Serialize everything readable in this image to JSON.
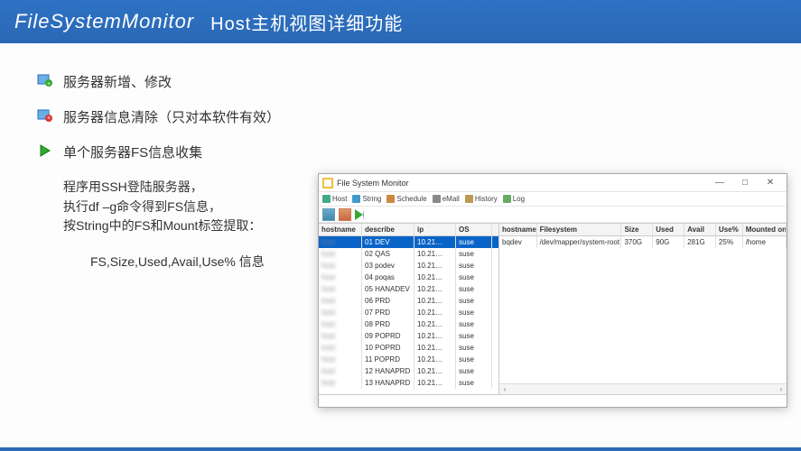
{
  "header": {
    "title": "FileSystemMonitor",
    "subtitle": "Host主机视图详细功能"
  },
  "bullets": {
    "b1": "服务器新增、修改",
    "b2": "服务器信息清除（只对本软件有效）",
    "b3": "单个服务器FS信息收集",
    "b3_lines": {
      "l1": "程序用SSH登陆服务器，",
      "l2": "执行df –g命令得到FS信息，",
      "l3": "按String中的FS和Mount标签提取：",
      "l4": "FS,Size,Used,Avail,Use% 信息"
    }
  },
  "window": {
    "title": "File System Monitor",
    "controls": {
      "min": "—",
      "max": "□",
      "close": "✕"
    },
    "menu": [
      "Host",
      "String",
      "Schedule",
      "eMail",
      "History",
      "Log"
    ],
    "left_headers": [
      "hostname",
      "describe",
      "ip",
      "OS"
    ],
    "left_rows": [
      {
        "hostname": "",
        "describe": "01 DEV",
        "ip": "10.21…",
        "os": "suse",
        "selected": true
      },
      {
        "hostname": "",
        "describe": "02 QAS",
        "ip": "10.21…",
        "os": "suse"
      },
      {
        "hostname": "",
        "describe": "03 podev",
        "ip": "10.21…",
        "os": "suse"
      },
      {
        "hostname": "",
        "describe": "04 poqas",
        "ip": "10.21…",
        "os": "suse"
      },
      {
        "hostname": "",
        "describe": "05 HANADEV",
        "ip": "10.21…",
        "os": "suse"
      },
      {
        "hostname": "",
        "describe": "06 PRD",
        "ip": "10.21…",
        "os": "suse"
      },
      {
        "hostname": "",
        "describe": "07 PRD",
        "ip": "10.21…",
        "os": "suse"
      },
      {
        "hostname": "",
        "describe": "08 PRD",
        "ip": "10.21…",
        "os": "suse"
      },
      {
        "hostname": "",
        "describe": "09 POPRD",
        "ip": "10.21…",
        "os": "suse"
      },
      {
        "hostname": "",
        "describe": "10 POPRD",
        "ip": "10.21…",
        "os": "suse"
      },
      {
        "hostname": "",
        "describe": "11 POPRD",
        "ip": "10.21…",
        "os": "suse"
      },
      {
        "hostname": "",
        "describe": "12 HANAPRD",
        "ip": "10.21…",
        "os": "suse"
      },
      {
        "hostname": "",
        "describe": "13 HANAPRD",
        "ip": "10.21…",
        "os": "suse"
      }
    ],
    "right_headers": [
      "hostname",
      "Filesystem",
      "Size",
      "Used",
      "Avail",
      "Use%",
      "Mounted on"
    ],
    "right_rows": [
      {
        "hostname": "bqdev",
        "fs": "/dev/mapper/system-root",
        "size": "370G",
        "used": "90G",
        "avail": "281G",
        "usepct": "25%",
        "mounted": "/home"
      }
    ]
  }
}
